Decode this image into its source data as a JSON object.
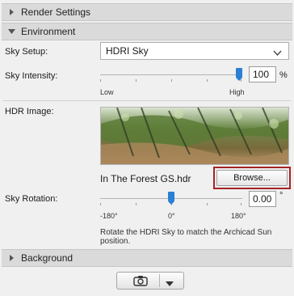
{
  "sections": {
    "render_settings": "Render Settings",
    "environment": "Environment",
    "background": "Background"
  },
  "sky_setup": {
    "label": "Sky Setup:",
    "value": "HDRI Sky"
  },
  "sky_intensity": {
    "label": "Sky Intensity:",
    "value": "100",
    "unit": "%",
    "slider_fraction": 1.0,
    "low_label": "Low",
    "high_label": "High"
  },
  "hdr_image": {
    "label": "HDR Image:",
    "filename": "In The Forest GS.hdr",
    "browse_label": "Browse..."
  },
  "sky_rotation": {
    "label": "Sky Rotation:",
    "value": "0.00",
    "unit": "°",
    "slider_fraction": 0.5,
    "min_label": "-180°",
    "mid_label": "0°",
    "max_label": "180°",
    "hint": "Rotate the HDRI Sky to match the Archicad Sun position."
  },
  "icons": [
    "triangle-right-icon",
    "triangle-down-icon",
    "chevron-down-icon",
    "camera-icon"
  ]
}
